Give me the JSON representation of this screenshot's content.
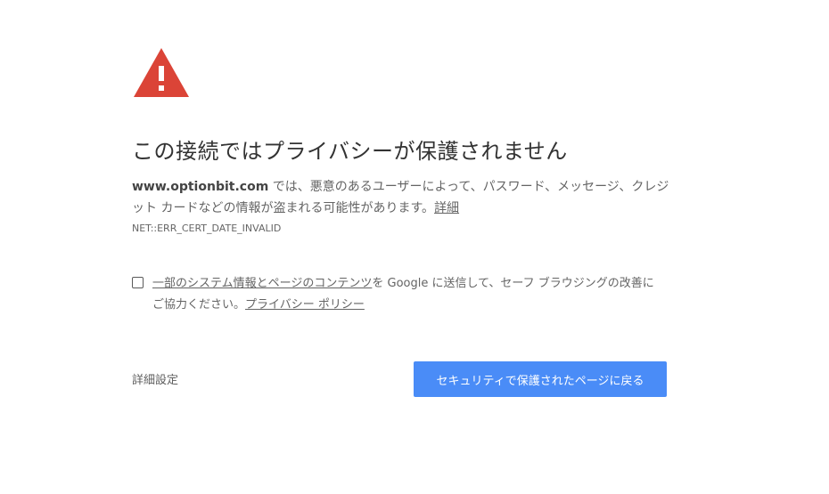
{
  "colors": {
    "warning_red": "#db4437",
    "button_blue": "#4a8cf7",
    "text_gray": "#646464"
  },
  "icon": {
    "name": "warning-triangle-icon"
  },
  "heading": "この接続ではプライバシーが保護されません",
  "description": {
    "domain": "www.optionbit.com",
    "text": " では、悪意のあるユーザーによって、パスワード、メッセージ、クレジット カードなどの情報が盗まれる可能性があります。",
    "details_link": "詳細"
  },
  "error_code": "NET::ERR_CERT_DATE_INVALID",
  "optin": {
    "link1": "一部のシステム情報とページのコンテンツ",
    "text1": "を Google に送信して、セーフ ブラウジングの改善にご協力ください。",
    "link2": "プライバシー ポリシー"
  },
  "buttons": {
    "advanced": "詳細設定",
    "back_to_safety": "セキュリティで保護されたページに戻る"
  }
}
